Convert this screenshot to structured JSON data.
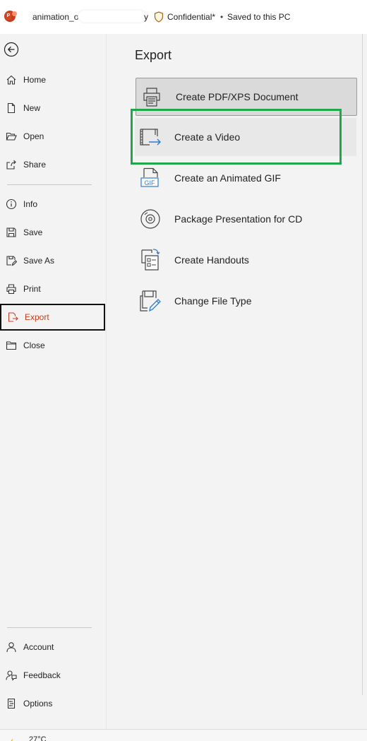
{
  "titlebar": {
    "file_prefix": "animation_o",
    "file_suffix": "y",
    "sensitivity": "Confidential*",
    "separator": "•",
    "save_status": "Saved to this PC"
  },
  "sidebar": {
    "back_label": "",
    "top_items": [
      {
        "label": "Home",
        "icon": "home-icon"
      },
      {
        "label": "New",
        "icon": "new-document-icon"
      },
      {
        "label": "Open",
        "icon": "open-folder-icon"
      },
      {
        "label": "Share",
        "icon": "share-icon"
      }
    ],
    "mid_items": [
      {
        "label": "Info",
        "icon": "info-icon"
      },
      {
        "label": "Save",
        "icon": "save-icon"
      },
      {
        "label": "Save As",
        "icon": "save-as-icon"
      },
      {
        "label": "Print",
        "icon": "print-icon"
      },
      {
        "label": "Export",
        "icon": "export-icon",
        "active": true
      },
      {
        "label": "Close",
        "icon": "close-folder-icon"
      }
    ],
    "bottom_items": [
      {
        "label": "Account",
        "icon": "account-icon"
      },
      {
        "label": "Feedback",
        "icon": "feedback-icon"
      },
      {
        "label": "Options",
        "icon": "options-icon"
      }
    ]
  },
  "main": {
    "title": "Export",
    "items": [
      {
        "label": "Create PDF/XPS Document",
        "icon": "pdf-printer-icon",
        "state": "selected"
      },
      {
        "label": "Create a Video",
        "icon": "video-icon",
        "state": "hover"
      },
      {
        "label": "Create an Animated GIF",
        "icon": "gif-icon"
      },
      {
        "label": "Package Presentation for CD",
        "icon": "cd-icon"
      },
      {
        "label": "Create Handouts",
        "icon": "handouts-icon"
      },
      {
        "label": "Change File Type",
        "icon": "change-file-type-icon"
      }
    ]
  },
  "taskbar": {
    "temperature": "27°C"
  },
  "colors": {
    "accent": "#c43e1c",
    "highlight": "#1fa84a",
    "sidebar_bg": "#f3f3f3"
  }
}
